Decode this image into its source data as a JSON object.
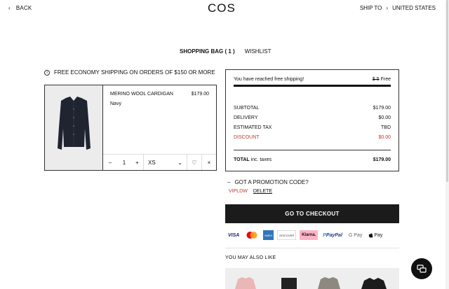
{
  "header": {
    "back_label": "BACK",
    "logo": "COS",
    "ship_to_label": "SHIP TO",
    "ship_to_value": "UNITED STATES"
  },
  "tabs": [
    {
      "label": "SHOPPING BAG ( 1 )",
      "active": true
    },
    {
      "label": "WISHLIST",
      "active": false
    }
  ],
  "free_shipping_notice": "FREE ECONOMY SHIPPING ON ORDERS OF $150 OR MORE",
  "cart_item": {
    "name": "MERINO WOOL CARDIGAN",
    "price": "$179.00",
    "color": "Navy",
    "quantity": "1",
    "size": "XS",
    "minus": "–",
    "plus": "+",
    "remove": "×"
  },
  "summary": {
    "free_shipping_msg": "You have reached free shipping!",
    "old_shipping": "$ 5",
    "new_shipping": "Free",
    "subtotal_label": "SUBTOTAL",
    "subtotal_value": "$179.00",
    "delivery_label": "DELIVERY",
    "delivery_value": "$0.00",
    "tax_label": "ESTIMATED TAX",
    "tax_value": "TBD",
    "discount_label": "DISCOUNT",
    "discount_value": "$0.00",
    "total_label": "TOTAL",
    "total_note": "inc. taxes",
    "total_value": "$179.00",
    "discount_color": "#c0392b"
  },
  "promo": {
    "toggle_icon": "–",
    "label": "GOT A PROMOTION CODE?",
    "code": "VIPLDW",
    "delete_label": "DELETE"
  },
  "checkout_label": "GO TO CHECKOUT",
  "payments": [
    "VISA",
    "Mastercard",
    "AMEX",
    "DISCOVER",
    "Klarna.",
    "PayPal",
    "G Pay",
    "Pay"
  ],
  "may_also_like": "YOU MAY ALSO LIKE"
}
